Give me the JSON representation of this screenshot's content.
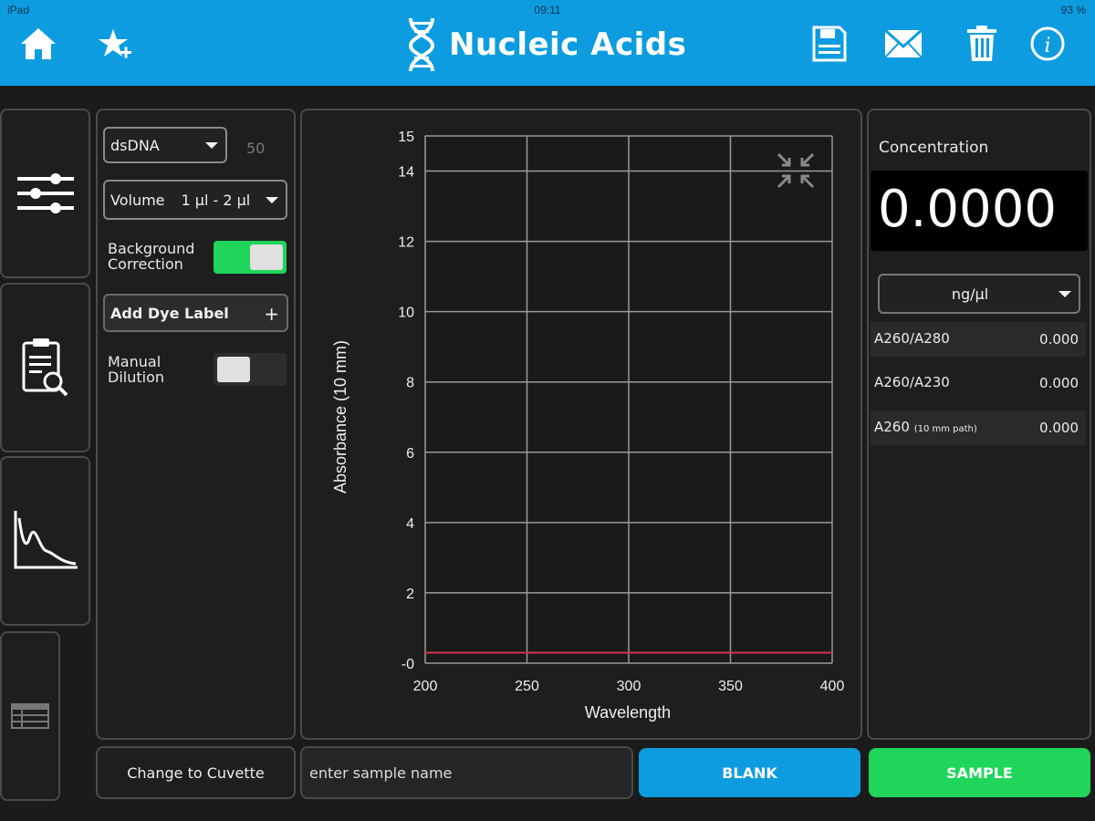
{
  "status_bar": {
    "device": "iPad",
    "time": "09:11",
    "battery": "93 %"
  },
  "header": {
    "title": "Nucleic Acids",
    "icons": [
      "home-icon",
      "favorites-add-icon",
      "save-icon",
      "mail-icon",
      "trash-icon",
      "info-icon"
    ]
  },
  "nav": {
    "items": [
      "settings-sliders-icon",
      "clipboard-search-icon",
      "spectrum-chart-icon",
      "table-icon"
    ]
  },
  "settings": {
    "sample_type": "dsDNA",
    "factor": "50",
    "volume_label": "Volume",
    "volume_value": "1 µl - 2 µl",
    "background_correction_line1": "Background",
    "background_correction_line2": "Correction",
    "background_correction_on": true,
    "add_dye_label": "Add Dye Label",
    "add_dye_plus": "+",
    "manual_dilution_line1": "Manual",
    "manual_dilution_line2": "Dilution",
    "manual_dilution_on": false
  },
  "chart_data": {
    "type": "line",
    "xlabel": "Wavelength",
    "ylabel": "Absorbance (10 mm)",
    "xlim": [
      200,
      400
    ],
    "ylim": [
      0,
      15
    ],
    "xticks": [
      200,
      250,
      300,
      350,
      400
    ],
    "yticks": [
      0,
      2,
      4,
      6,
      8,
      10,
      12,
      14,
      15
    ],
    "ytick_labels": [
      "-0",
      "2",
      "4",
      "6",
      "8",
      "10",
      "12",
      "14",
      "15"
    ],
    "grid": true,
    "series": [
      {
        "x": [
          200,
          400
        ],
        "values": [
          0.3,
          0.3
        ],
        "color": "#d6324a"
      }
    ]
  },
  "results": {
    "concentration_label": "Concentration",
    "concentration_value": "0.0000",
    "unit": "ng/µl",
    "rows": [
      {
        "label": "A260/A280",
        "small": "",
        "value": "0.000"
      },
      {
        "label": "A260/A230",
        "small": "",
        "value": "0.000"
      },
      {
        "label": "A260",
        "small": "(10 mm path)",
        "value": "0.000"
      }
    ]
  },
  "bottom": {
    "change_cuvette": "Change to Cuvette",
    "sample_name_placeholder": "enter sample name",
    "blank": "BLANK",
    "sample": "SAMPLE"
  },
  "colors": {
    "header": "#0d9ce0",
    "toggle_on": "#1fd65a",
    "blank": "#0d9ce0",
    "sample": "#1fd65a",
    "trace": "#d6324a"
  }
}
